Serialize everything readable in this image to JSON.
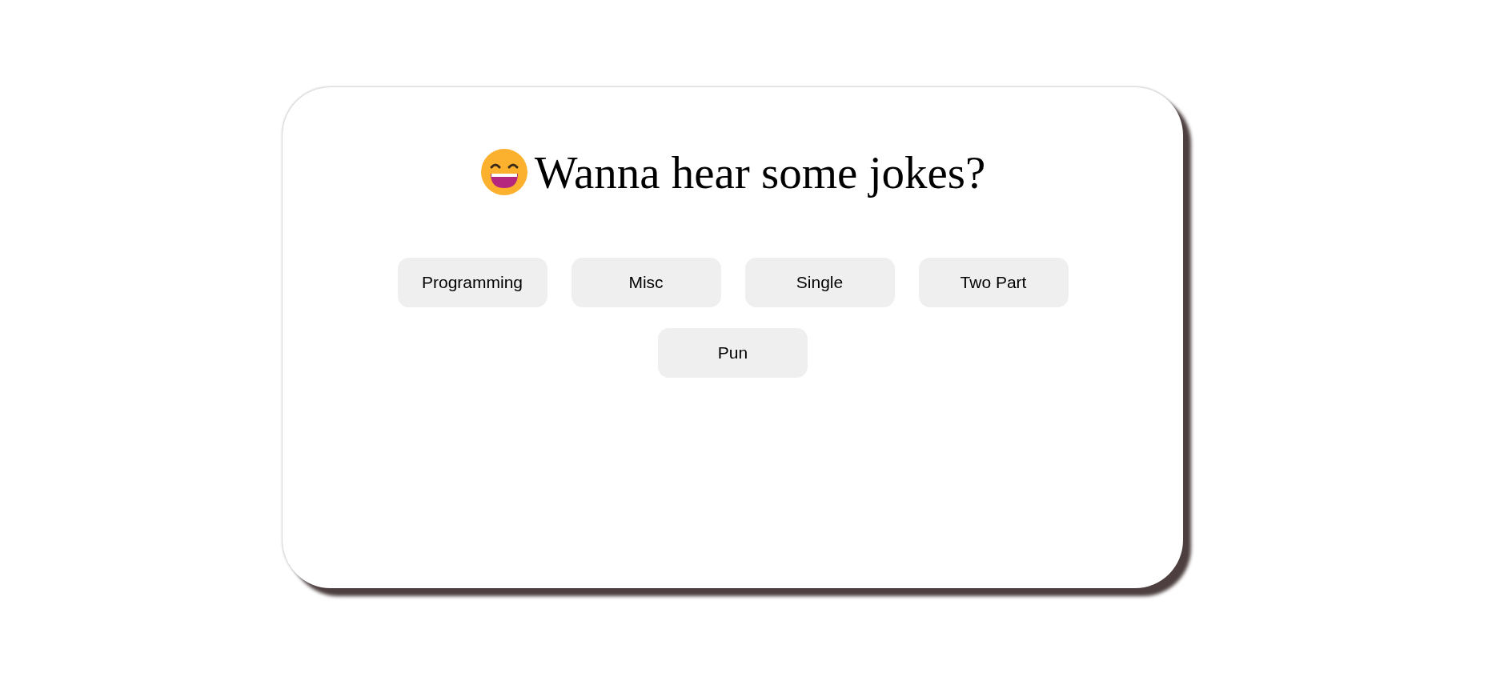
{
  "heading": "Wanna hear some jokes?",
  "categories": [
    {
      "label": "Programming"
    },
    {
      "label": "Misc"
    },
    {
      "label": "Single"
    },
    {
      "label": "Two Part"
    },
    {
      "label": "Pun"
    }
  ]
}
